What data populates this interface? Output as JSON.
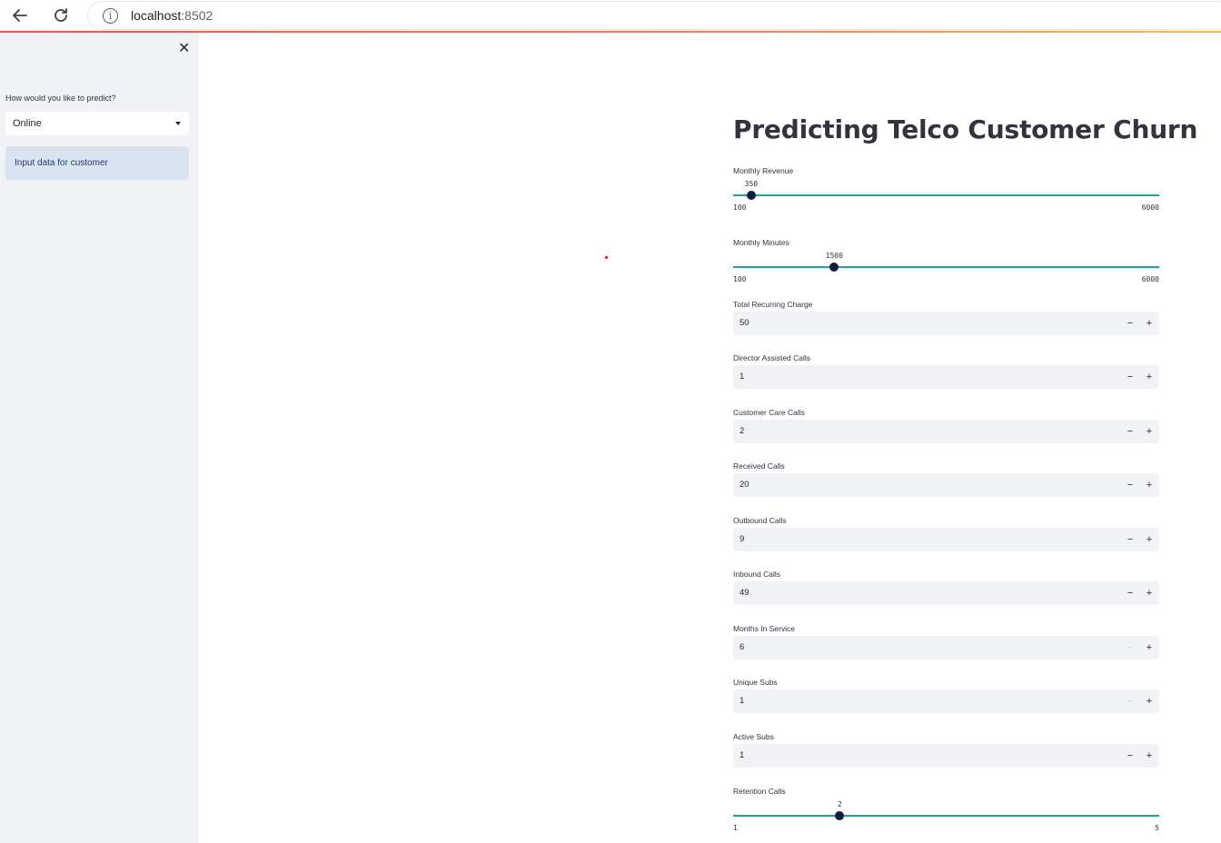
{
  "browser": {
    "url_host": "localhost",
    "url_port": ":8502"
  },
  "sidebar": {
    "close_icon": "close-icon",
    "predict_label": "How would you like to predict?",
    "predict_value": "Online",
    "info_text": "Input data for customer"
  },
  "main": {
    "title": "Predicting Telco Customer Churn",
    "sliders": [
      {
        "label": "Monthly Revenue",
        "value": 350,
        "min": 100,
        "max": 6000
      },
      {
        "label": "Monthly Minutes",
        "value": 1500,
        "min": 100,
        "max": 6000
      },
      {
        "label": "Retention Calls",
        "value": 2,
        "min": 1,
        "max": 5
      }
    ],
    "inputs": [
      {
        "label": "Total Recurring Charge",
        "value": "50",
        "minus_disabled": false
      },
      {
        "label": "Director Assisted Calls",
        "value": "1",
        "minus_disabled": false
      },
      {
        "label": "Customer Care Calls",
        "value": "2",
        "minus_disabled": false
      },
      {
        "label": "Received Calls",
        "value": "20",
        "minus_disabled": false
      },
      {
        "label": "Outbound Calls",
        "value": "9",
        "minus_disabled": false
      },
      {
        "label": "Inbound Calls",
        "value": "49",
        "minus_disabled": false
      },
      {
        "label": "Months In Service",
        "value": "6",
        "minus_disabled": true
      },
      {
        "label": "Unique Subs",
        "value": "1",
        "minus_disabled": true
      },
      {
        "label": "Active Subs",
        "value": "1",
        "minus_disabled": false
      }
    ],
    "minus_symbol": "−",
    "plus_symbol": "+"
  },
  "colors": {
    "accent": "#1fa398",
    "thumb": "#0e1f3c",
    "sidebar_bg": "#f0f2f6",
    "info_bg": "#d9e4f2"
  }
}
